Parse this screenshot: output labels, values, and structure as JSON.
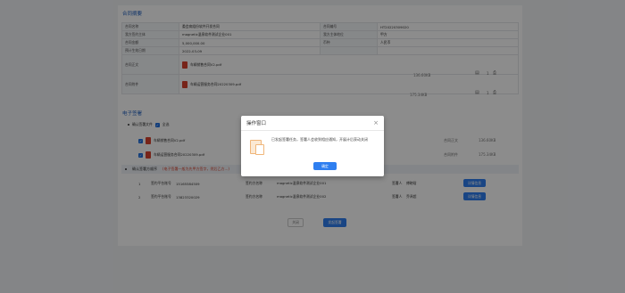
{
  "contract_summary": {
    "section_title": "合同摘要",
    "rows": [
      [
        "合同名称",
        "委会病组份软件开发合同",
        "合同编号",
        "HT20220309020"
      ],
      [
        "我方签约主体",
        "magnetic温泉软件测试企业001",
        "我方主体地位",
        "甲方"
      ],
      [
        "合同金额",
        "5,000,000.00",
        "币种",
        "人民币"
      ],
      [
        "预计生效日期",
        "2022-03-09",
        "",
        ""
      ]
    ],
    "main_label": "合同正文",
    "main_file": "车辆销售合同V2.pdf",
    "main_size": "136.60KB",
    "attach_label": "合同附件",
    "attach_file": "车辆运营服务合同20220309.pdf",
    "attach_size": "175.34KB",
    "icon_count": "1"
  },
  "e_sign": {
    "section_title": "电子签署",
    "confirm_files_label": "确认签署文件",
    "select_all": "全选",
    "files": [
      {
        "name": "车辆销售合同V2.pdf",
        "type": "合同正文",
        "size": "136.60KB"
      },
      {
        "name": "车辆运营服务合同20220309.pdf",
        "type": "合同附件",
        "size": "175.34KB"
      }
    ],
    "order_label": "确认签署方顺序",
    "order_warning": "(电子签署一般为先甲方签字，然后乙方...)",
    "signers": [
      {
        "idx": "1",
        "acct_label": "签约平台账号",
        "acct": "15165584509",
        "party_label": "签约方名称",
        "party": "magnetic温泉软件测试企业001",
        "person_label": "签署人",
        "person": "傅晓晗",
        "btn": "详情信息"
      },
      {
        "idx": "2",
        "acct_label": "签约平台账号",
        "acct": "13823320029",
        "party_label": "签约方名称",
        "party": "magnetic温泉软件测试企业002",
        "person_label": "签署人",
        "person": "乔泽超",
        "btn": "详情信息"
      }
    ],
    "back_btn": "关闭",
    "submit_btn": "发起签署"
  },
  "modal": {
    "title": "操作窗口",
    "message": "已发起签署任务，签署人会收到相应通知，开展计后获动关闭",
    "ok": "确定"
  }
}
